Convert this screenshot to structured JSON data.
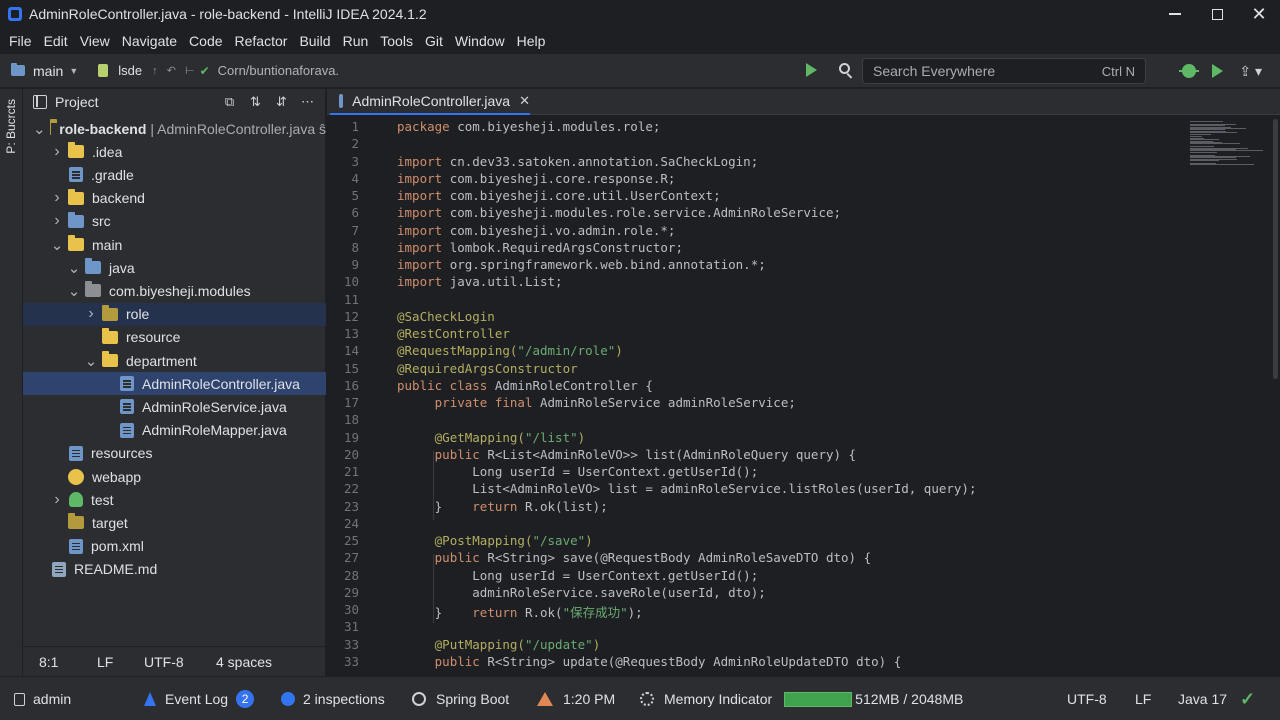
{
  "window": {
    "title": "AdminRoleController.java - role-backend - IntelliJ IDEA 2024.1.2"
  },
  "menu": [
    "File",
    "Edit",
    "View",
    "Navigate",
    "Code",
    "Refactor",
    "Build",
    "Run",
    "Tools",
    "Git",
    "Window",
    "Help"
  ],
  "toolbar": {
    "branch": "main",
    "vcs_label": "lsde",
    "commit_text": "Corn/buntionaforava.",
    "search_placeholder": "Search Everywhere",
    "search_shortcut": "Ctrl N"
  },
  "left_strip": {
    "label": "P: Bucrcts"
  },
  "project": {
    "title": "Project",
    "tree": [
      {
        "label": "role-backend",
        "sub": "| AdminRoleController.java ŝ",
        "depth": 0,
        "expanded": true,
        "icon": "folder-olive",
        "bold": true
      },
      {
        "label": ".idea",
        "depth": 1,
        "expanded": false,
        "icon": "folder"
      },
      {
        "label": ".gradle",
        "depth": 1,
        "leaf": true,
        "icon": "file-gradle"
      },
      {
        "label": "backend",
        "depth": 1,
        "expanded": false,
        "icon": "folder"
      },
      {
        "label": "src",
        "depth": 1,
        "expanded": false,
        "icon": "folder-blue"
      },
      {
        "label": "main",
        "depth": 1,
        "expanded": true,
        "icon": "folder"
      },
      {
        "label": "java",
        "depth": 2,
        "expanded": true,
        "icon": "folder-blue"
      },
      {
        "label": "com.biyesheji.modules",
        "depth": 2,
        "expanded": true,
        "icon": "folder-gray"
      },
      {
        "label": "role",
        "depth": 3,
        "expanded": false,
        "icon": "folder-olive",
        "selected": "light"
      },
      {
        "label": "resource",
        "depth": 3,
        "leaf": true,
        "icon": "folder"
      },
      {
        "label": "department",
        "depth": 3,
        "expanded": true,
        "icon": "folder"
      },
      {
        "label": "AdminRoleController.java",
        "depth": 4,
        "leaf": true,
        "icon": "file-java",
        "selected": "strong"
      },
      {
        "label": "AdminRoleService.java",
        "depth": 4,
        "leaf": true,
        "icon": "file-java"
      },
      {
        "label": "AdminRoleMapper.java",
        "depth": 4,
        "leaf": true,
        "icon": "file-java"
      },
      {
        "label": "resources",
        "depth": 1,
        "leaf": true,
        "icon": "file-java"
      },
      {
        "label": "webapp",
        "depth": 1,
        "leaf": true,
        "icon": "gear"
      },
      {
        "label": "test",
        "depth": 1,
        "expanded": false,
        "icon": "test"
      },
      {
        "label": "target",
        "depth": 1,
        "leaf": true,
        "icon": "folder-olive"
      },
      {
        "label": "pom.xml",
        "depth": 1,
        "leaf": true,
        "icon": "file-java"
      },
      {
        "label": "README.md",
        "depth": 0,
        "leaf": true,
        "icon": "file-md"
      }
    ],
    "status": {
      "position": "8:1",
      "line_sep": "LF",
      "encoding": "UTF-8",
      "indent": "4 spaces"
    }
  },
  "editor": {
    "tab_label": "AdminRoleController.java",
    "lines": [
      {
        "n": "1",
        "tokens": [
          [
            "kw",
            "package "
          ],
          [
            "",
            "com.biyesheji.modules.role;"
          ]
        ]
      },
      {
        "n": "2",
        "tokens": []
      },
      {
        "n": "3",
        "tokens": [
          [
            "kw",
            "import "
          ],
          [
            "",
            "cn.dev33.satoken.annotation.SaCheckLogin;"
          ]
        ]
      },
      {
        "n": "4",
        "tokens": [
          [
            "kw",
            "import "
          ],
          [
            "",
            "com.biyesheji.core.response.R;"
          ]
        ]
      },
      {
        "n": "5",
        "tokens": [
          [
            "kw",
            "import "
          ],
          [
            "",
            "com.biyesheji.core.util.UserContext;"
          ]
        ]
      },
      {
        "n": "6",
        "tokens": [
          [
            "kw",
            "import "
          ],
          [
            "",
            "com.biyesheji.modules.role.service.AdminRoleService;"
          ]
        ]
      },
      {
        "n": "7",
        "tokens": [
          [
            "kw",
            "import "
          ],
          [
            "",
            "com.biyesheji.vo.admin.role.*;"
          ]
        ]
      },
      {
        "n": "8",
        "tokens": [
          [
            "kw",
            "import "
          ],
          [
            "",
            "lombok.RequiredArgsConstructor;"
          ]
        ]
      },
      {
        "n": "9",
        "tokens": [
          [
            "kw",
            "import "
          ],
          [
            "",
            "org.springframework.web.bind.annotation.*;"
          ]
        ]
      },
      {
        "n": "10",
        "tokens": [
          [
            "kw",
            "import "
          ],
          [
            "",
            "java.util.List;"
          ]
        ]
      },
      {
        "n": "11",
        "tokens": []
      },
      {
        "n": "12",
        "tokens": [
          [
            "an",
            "@SaCheckLogin"
          ]
        ]
      },
      {
        "n": "13",
        "tokens": [
          [
            "an",
            "@RestController"
          ]
        ]
      },
      {
        "n": "14",
        "tokens": [
          [
            "an",
            "@RequestMapping("
          ],
          [
            "st",
            "\"/admin/role\""
          ],
          [
            "an",
            ")"
          ]
        ]
      },
      {
        "n": "15",
        "tokens": [
          [
            "an",
            "@RequiredArgsConstructor"
          ]
        ]
      },
      {
        "n": "16",
        "tokens": [
          [
            "kw",
            "public class "
          ],
          [
            "",
            "AdminRoleController {"
          ]
        ]
      },
      {
        "n": "17",
        "tokens": [
          [
            "",
            "     "
          ],
          [
            "kw",
            "private final "
          ],
          [
            "",
            "AdminRoleService adminRoleService;"
          ]
        ]
      },
      {
        "n": "18",
        "tokens": []
      },
      {
        "n": "19",
        "tokens": [
          [
            "",
            "     "
          ],
          [
            "an",
            "@GetMapping("
          ],
          [
            "st",
            "\"/list\""
          ],
          [
            "an",
            ")"
          ]
        ]
      },
      {
        "n": "20",
        "tokens": [
          [
            "",
            "     "
          ],
          [
            "kw",
            "public "
          ],
          [
            "",
            "R<List<AdminRoleVO>> list(AdminRoleQuery query) {"
          ]
        ]
      },
      {
        "n": "21",
        "tokens": [
          [
            "",
            "          Long userId = UserContext.getUserId();"
          ]
        ]
      },
      {
        "n": "22",
        "tokens": [
          [
            "",
            "          List<AdminRoleVO> list = adminRoleService.listRoles(userId, query);"
          ]
        ]
      },
      {
        "n": "23",
        "tokens": [
          [
            "",
            "     }    "
          ],
          [
            "kw",
            "return "
          ],
          [
            "",
            "R.ok(list);"
          ]
        ]
      },
      {
        "n": "24",
        "tokens": []
      },
      {
        "n": "25",
        "tokens": [
          [
            "",
            "     "
          ],
          [
            "an",
            "@PostMapping("
          ],
          [
            "st",
            "\"/save\""
          ],
          [
            "an",
            ")"
          ]
        ]
      },
      {
        "n": "27",
        "tokens": [
          [
            "",
            "     "
          ],
          [
            "kw",
            "public "
          ],
          [
            "",
            "R<String> save(@RequestBody AdminRoleSaveDTO dto) {"
          ]
        ]
      },
      {
        "n": "28",
        "tokens": [
          [
            "",
            "          Long userId = UserContext.getUserId();"
          ]
        ]
      },
      {
        "n": "29",
        "tokens": [
          [
            "",
            "          adminRoleService.saveRole(userId, dto);"
          ]
        ]
      },
      {
        "n": "30",
        "tokens": [
          [
            "",
            "     }    "
          ],
          [
            "kw",
            "return "
          ],
          [
            "",
            "R.ok("
          ],
          [
            "st",
            "\"保存成功\""
          ],
          [
            "",
            ");"
          ]
        ]
      },
      {
        "n": "31",
        "tokens": []
      },
      {
        "n": "33",
        "tokens": [
          [
            "",
            "     "
          ],
          [
            "an",
            "@PutMapping("
          ],
          [
            "st",
            "\"/update\""
          ],
          [
            "an",
            ")"
          ]
        ]
      },
      {
        "n": "33",
        "tokens": [
          [
            "",
            "     "
          ],
          [
            "kw",
            "public "
          ],
          [
            "",
            "R<String> update(@RequestBody AdminRoleUpdateDTO dto) {"
          ]
        ]
      }
    ]
  },
  "statusbar": {
    "user": "admin",
    "event_log": "Event Log",
    "event_count": "2",
    "inspections": "2 inspections",
    "spring": "Spring Boot",
    "time": "1:20 PM",
    "memory_label": "Memory Indicator",
    "memory_value": "512MB / 2048MB",
    "memory_fraction": 0.25,
    "encoding": "UTF-8",
    "line_sep": "LF",
    "java": "Java 17"
  }
}
